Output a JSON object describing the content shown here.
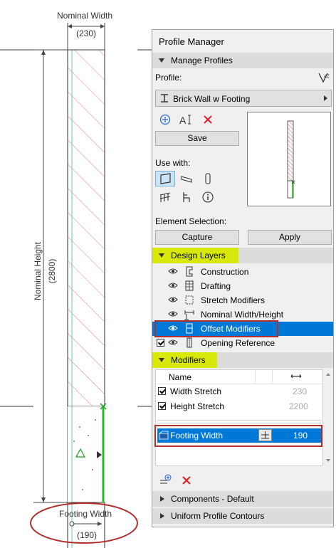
{
  "drawing": {
    "nominal_width_label": "Nominal Width",
    "nominal_width_value": "(230)",
    "nominal_height_label": "Nominal Height",
    "nominal_height_value": "(2800)",
    "footing_width_label": "Footing Width",
    "footing_width_value": "(190)"
  },
  "panel": {
    "title": "Profile Manager",
    "manage_profiles": "Manage Profiles",
    "profile_label": "Profile:",
    "profile_name": "Brick Wall w Footing",
    "save_label": "Save",
    "use_with_label": "Use with:",
    "element_selection_label": "Element Selection:",
    "capture_label": "Capture",
    "apply_label": "Apply",
    "design_layers_label": "Design Layers",
    "layers": [
      {
        "label": "Construction",
        "icon": "construction-icon"
      },
      {
        "label": "Drafting",
        "icon": "drafting-icon"
      },
      {
        "label": "Stretch Modifiers",
        "icon": "stretch-modifiers-icon"
      },
      {
        "label": "Nominal Width/Height",
        "icon": "nominal-dimension-icon"
      },
      {
        "label": "Offset Modifiers",
        "icon": "offset-modifiers-icon",
        "selected": true
      },
      {
        "label": "Opening Reference",
        "icon": "opening-reference-icon",
        "checked": true
      }
    ],
    "modifiers_label": "Modifiers",
    "modifiers_table": {
      "columns": [
        "Name",
        "⟷"
      ],
      "rows": [
        {
          "name": "Width Stretch",
          "value": "230",
          "checked": true
        },
        {
          "name": "Height Stretch",
          "value": "2200",
          "checked": true
        }
      ],
      "selected_row": {
        "name": "Footing Width",
        "value": "190"
      }
    },
    "components_label": "Components - Default",
    "uniform_contours_label": "Uniform Profile Contours"
  },
  "colors": {
    "selection_blue": "#0078d7",
    "highlight_yellow": "#d8e80a",
    "callout_red": "#b03030",
    "hatch_red": "#e08080",
    "modifier_green": "#22c022"
  }
}
